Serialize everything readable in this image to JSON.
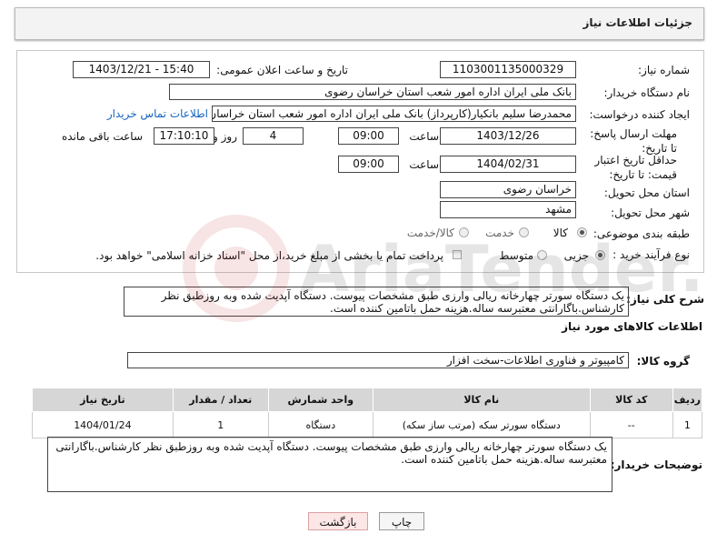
{
  "header": {
    "title": "جزئیات اطلاعات نیاز"
  },
  "form": {
    "need_number_label": "شماره نیاز:",
    "need_number": "1103001135000329",
    "announce_label": "تاریخ و ساعت اعلان عمومی:",
    "announce_value": "1403/12/21 - 15:40",
    "buyer_label": "نام دستگاه خریدار:",
    "buyer_value": "بانک ملی ایران اداره امور شعب استان خراسان رضوی",
    "creator_label": "ایجاد کننده درخواست:",
    "creator_value": "محمدرضا سلیم  بانکیار(کارپرداز) بانک ملی ایران اداره امور شعب استان خراسان",
    "contact_link": "اطلاعات تماس خریدار",
    "reply_label": "مهلت ارسال پاسخ: تا تاریخ:",
    "reply_date": "1403/12/26",
    "time_label": "ساعت",
    "reply_time": "09:00",
    "days_value": "4",
    "days_label": "روز و",
    "remaining_time": "17:10:10",
    "remaining_label": "ساعت باقی مانده",
    "validity_label": "حداقل تاریخ اعتبار قیمت: تا تاریخ:",
    "validity_date": "1404/02/31",
    "validity_time": "09:00",
    "province_label": "استان محل تحویل:",
    "province_value": "خراسان رضوی",
    "city_label": "شهر محل تحویل:",
    "city_value": "مشهد",
    "category_label": "طبقه بندی موضوعی:",
    "category_options": [
      "کالا",
      "خدمت",
      "کالا/خدمت"
    ],
    "category_selected": "کالا",
    "process_label": "نوع فرآیند خرید :",
    "process_options": [
      "جزیی",
      "متوسط"
    ],
    "process_selected": "جزیی",
    "payment_note": "پرداخت تمام یا بخشی از مبلغ خرید،از محل \"اسناد خزانه اسلامی\" خواهد بود."
  },
  "description": {
    "label": "شرح کلی نیاز:",
    "text": "یک دستگاه سورتر چهارخانه ریالی وارزی طبق مشخصات پیوست. دستگاه آپدیت شده وبه روزطبق نظر کارشناس.باگارانتی معتبرسه ساله.هزینه حمل باتامین کننده است."
  },
  "items_section": {
    "title": "اطلاعات کالاهای مورد نیاز",
    "group_label": "گروه کالا:",
    "group_value": "کامپیوتر و فناوری اطلاعات-سخت افزار",
    "columns": [
      "ردیف",
      "کد کالا",
      "نام کالا",
      "واحد شمارش",
      "تعداد / مقدار",
      "تاریخ نیاز"
    ],
    "rows": [
      [
        "1",
        "--",
        "دستگاه سورتر سکه (مرتب ساز سکه)",
        "دستگاه",
        "1",
        "1404/01/24"
      ]
    ]
  },
  "buyer_notes": {
    "label": "توضیحات خریدار:",
    "text": "یک دستگاه سورتر چهارخانه ریالی وارزی طبق مشخصات پیوست. دستگاه آپدیت شده وبه روزطبق نظر کارشناس.باگارانتی معتبرسه ساله.هزینه حمل باتامین کننده است."
  },
  "buttons": {
    "print": "چاپ",
    "back": "بازگشت"
  },
  "watermark": {
    "brand": "AriaTender.net"
  }
}
